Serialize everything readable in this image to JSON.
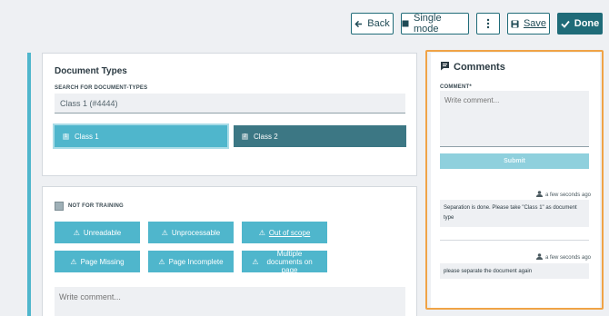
{
  "toolbar": {
    "back_label": "Back",
    "single_mode_label": "Single mode",
    "save_label": "Save",
    "done_label": "Done"
  },
  "document_types": {
    "title": "Document Types",
    "search_label": "SEARCH FOR DOCUMENT-TYPES",
    "search_value": "Class 1 (#4444)",
    "classes": [
      {
        "label": "Class 1",
        "badge": "1"
      },
      {
        "label": "Class 2",
        "badge": "2"
      }
    ]
  },
  "review": {
    "not_for_training_label": "NOT FOR TRAINING",
    "buttons": [
      {
        "label": "Unreadable"
      },
      {
        "label": "Unprocessable"
      },
      {
        "label": "Out of scope"
      },
      {
        "label": "Page Missing"
      },
      {
        "label": "Page Incomplete"
      },
      {
        "label": "Multiple documents on page"
      }
    ],
    "comment_placeholder": "Write comment..."
  },
  "comments_panel": {
    "title": "Comments",
    "comment_label": "COMMENT*",
    "comment_placeholder": "Write comment...",
    "submit_label": "Submit",
    "comments": [
      {
        "time": "a few seconds ago",
        "text": "Separation is done. Please take \"Class 1\" as document type"
      },
      {
        "time": "a few seconds ago",
        "text": "please separate the document again"
      }
    ]
  },
  "colors": {
    "accent": "#4fb6cc",
    "dark_teal": "#1f6b78",
    "highlight_outline": "#f0a346"
  }
}
